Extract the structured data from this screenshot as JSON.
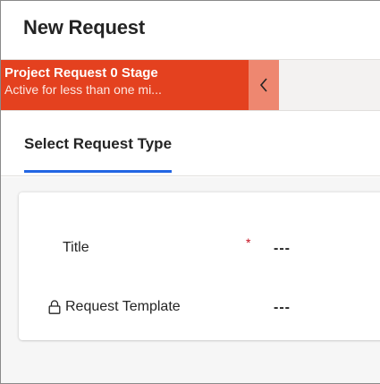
{
  "form": {
    "title": "New Request"
  },
  "bpf": {
    "stage_name": "Project Request 0 Stage",
    "stage_duration": "Active for less than one mi..."
  },
  "tabs": [
    {
      "label": "Select Request Type",
      "selected": true
    }
  ],
  "fields": {
    "title": {
      "label": "Title",
      "required_marker": "*",
      "value": "---"
    },
    "request_template": {
      "label": "Request Template",
      "value": "---",
      "locked": true
    }
  },
  "colors": {
    "stage_active": "#e4411f",
    "collapse_button": "#ee8770",
    "tab_underline": "#2266e3",
    "required": "#c50f1f"
  },
  "icons": {
    "collapse": "chevron-left-icon",
    "locked": "lock-icon"
  }
}
